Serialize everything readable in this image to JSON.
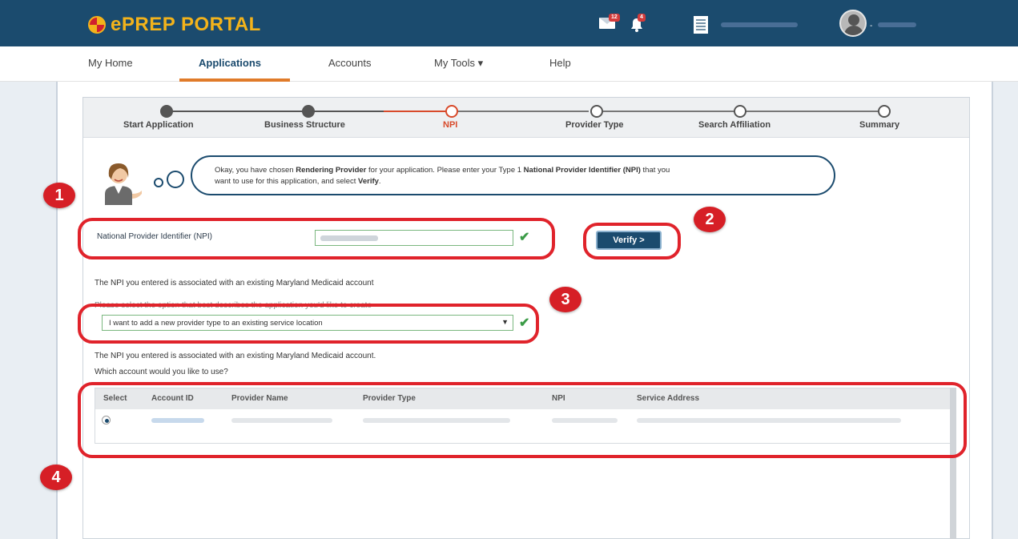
{
  "header": {
    "logo": "ePREP PORTAL",
    "mail_badge": "12",
    "bell_badge": "4",
    "user_caret": "-"
  },
  "nav": {
    "items": [
      {
        "label": "My Home"
      },
      {
        "label": "Applications"
      },
      {
        "label": "Accounts"
      },
      {
        "label": "My Tools ▾"
      },
      {
        "label": "Help"
      }
    ]
  },
  "stepper": {
    "steps": [
      {
        "label": "Start Application",
        "state": "done"
      },
      {
        "label": "Business Structure",
        "state": "done"
      },
      {
        "label": "NPI",
        "state": "current"
      },
      {
        "label": "Provider Type",
        "state": "upcoming"
      },
      {
        "label": "Search Affiliation",
        "state": "upcoming"
      },
      {
        "label": "Summary",
        "state": "upcoming"
      }
    ]
  },
  "assistant": {
    "line1_a": "Okay, you have chosen ",
    "line1_b": "Rendering Provider",
    "line1_c": " for your application. Please enter your Type 1 ",
    "line1_d": "National Provider Identifier (NPI)",
    "line1_e": " that you",
    "line2_a": "want to use for this application, and select ",
    "line2_b": "Verify",
    "line2_c": "."
  },
  "npi": {
    "label": "National Provider Identifier (NPI)",
    "verify_label": "Verify >"
  },
  "messages": {
    "existing_account": "The NPI you entered is associated with an existing Maryland Medicaid account",
    "select_prompt": "Please select the option that best describes the application you'd like to create",
    "existing_account2": "The NPI you entered is associated with an existing Maryland Medicaid account.",
    "which_account": "Which account would you like to use?"
  },
  "app_option": {
    "selected": "I want to add a new provider type to an existing service location"
  },
  "table": {
    "headers": [
      "Select",
      "Account ID",
      "Provider Name",
      "Provider Type",
      "NPI",
      "Service Address"
    ]
  },
  "annotations": [
    "1",
    "2",
    "3",
    "4"
  ],
  "colors": {
    "header_bg": "#1b4b6e",
    "accent_orange": "#e07b2a",
    "annotation_red": "#e0232b",
    "valid_green": "#3b9b47"
  }
}
